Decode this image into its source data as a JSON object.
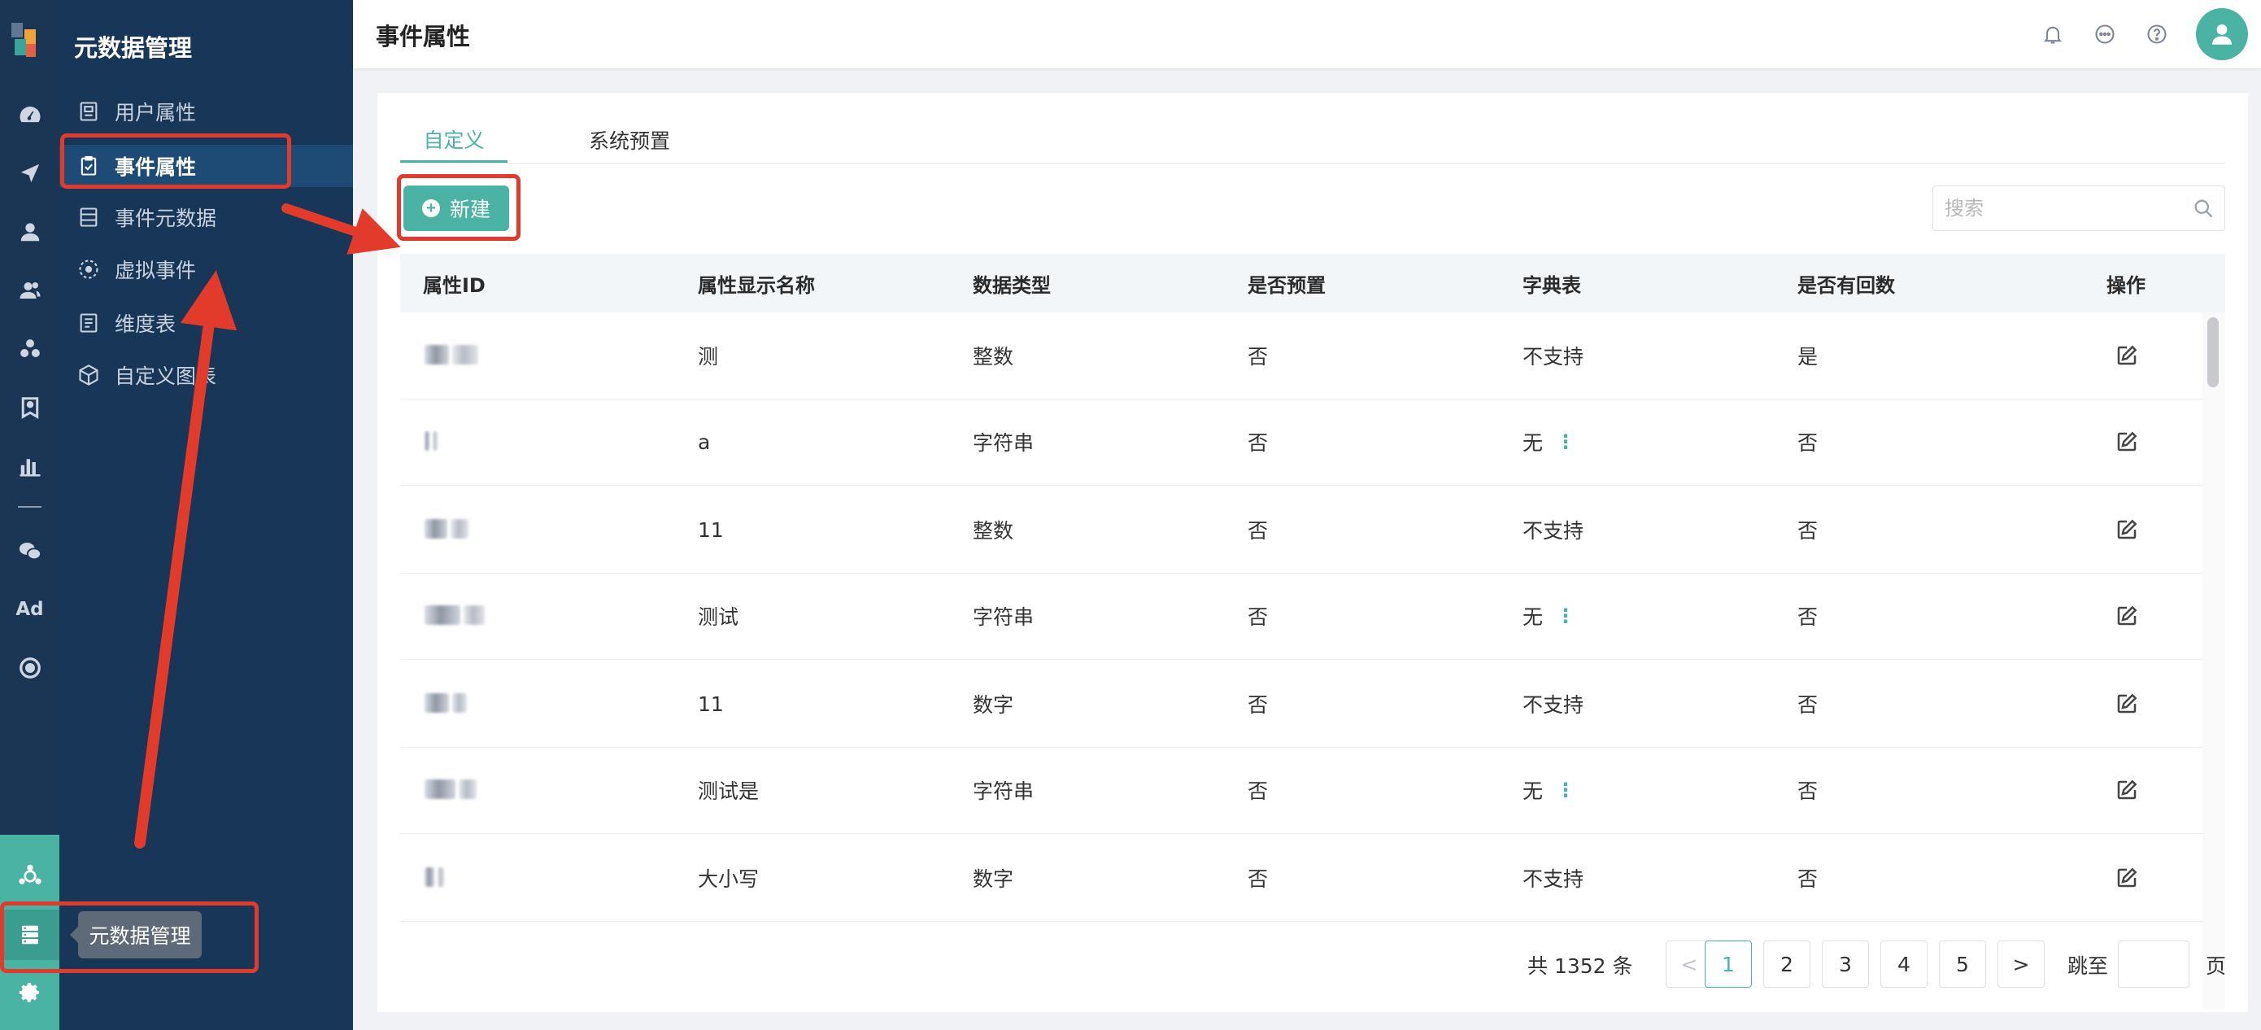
{
  "menu": {
    "title": "元数据管理",
    "items": [
      {
        "label": "用户属性",
        "icon": "user-attribute-icon"
      },
      {
        "label": "事件属性",
        "icon": "clipboard-check-icon",
        "active": true
      },
      {
        "label": "事件元数据",
        "icon": "database-list-icon"
      },
      {
        "label": "虚拟事件",
        "icon": "virtual-event-icon"
      },
      {
        "label": "维度表",
        "icon": "dimension-table-icon"
      },
      {
        "label": "自定义图表",
        "icon": "cube-icon"
      }
    ]
  },
  "rail": {
    "ad_label": "Ad",
    "tooltip": "元数据管理"
  },
  "header": {
    "title": "事件属性"
  },
  "tabs": [
    {
      "label": "自定义",
      "active": true
    },
    {
      "label": "系统预置",
      "active": false
    }
  ],
  "toolbar": {
    "new_label": "新建",
    "search_placeholder": "搜索"
  },
  "table": {
    "columns": [
      "属性ID",
      "属性显示名称",
      "数据类型",
      "是否预置",
      "字典表",
      "是否有回数",
      "操作"
    ],
    "rows": [
      {
        "name": "测",
        "type": "整数",
        "preset": "否",
        "dict": "不支持",
        "dict_menu": false,
        "backflow": "是"
      },
      {
        "name": "a",
        "type": "字符串",
        "preset": "否",
        "dict": "无",
        "dict_menu": true,
        "backflow": "否"
      },
      {
        "name": "11",
        "type": "整数",
        "preset": "否",
        "dict": "不支持",
        "dict_menu": false,
        "backflow": "否"
      },
      {
        "name": "测试",
        "type": "字符串",
        "preset": "否",
        "dict": "无",
        "dict_menu": true,
        "backflow": "否"
      },
      {
        "name": "11",
        "type": "数字",
        "preset": "否",
        "dict": "不支持",
        "dict_menu": false,
        "backflow": "否"
      },
      {
        "name": "测试是",
        "type": "字符串",
        "preset": "否",
        "dict": "无",
        "dict_menu": true,
        "backflow": "否"
      },
      {
        "name": "大小写",
        "type": "数字",
        "preset": "否",
        "dict": "不支持",
        "dict_menu": false,
        "backflow": "否"
      }
    ]
  },
  "pagination": {
    "total_text": "共 1352 条",
    "pages": [
      "1",
      "2",
      "3",
      "4",
      "5"
    ],
    "current": "1",
    "prev": "<",
    "next": ">",
    "jump_label": "跳至",
    "page_label": "页"
  },
  "colors": {
    "accent": "#4ab3a4",
    "sidebar": "#183657",
    "annotation": "#e23b2b"
  }
}
